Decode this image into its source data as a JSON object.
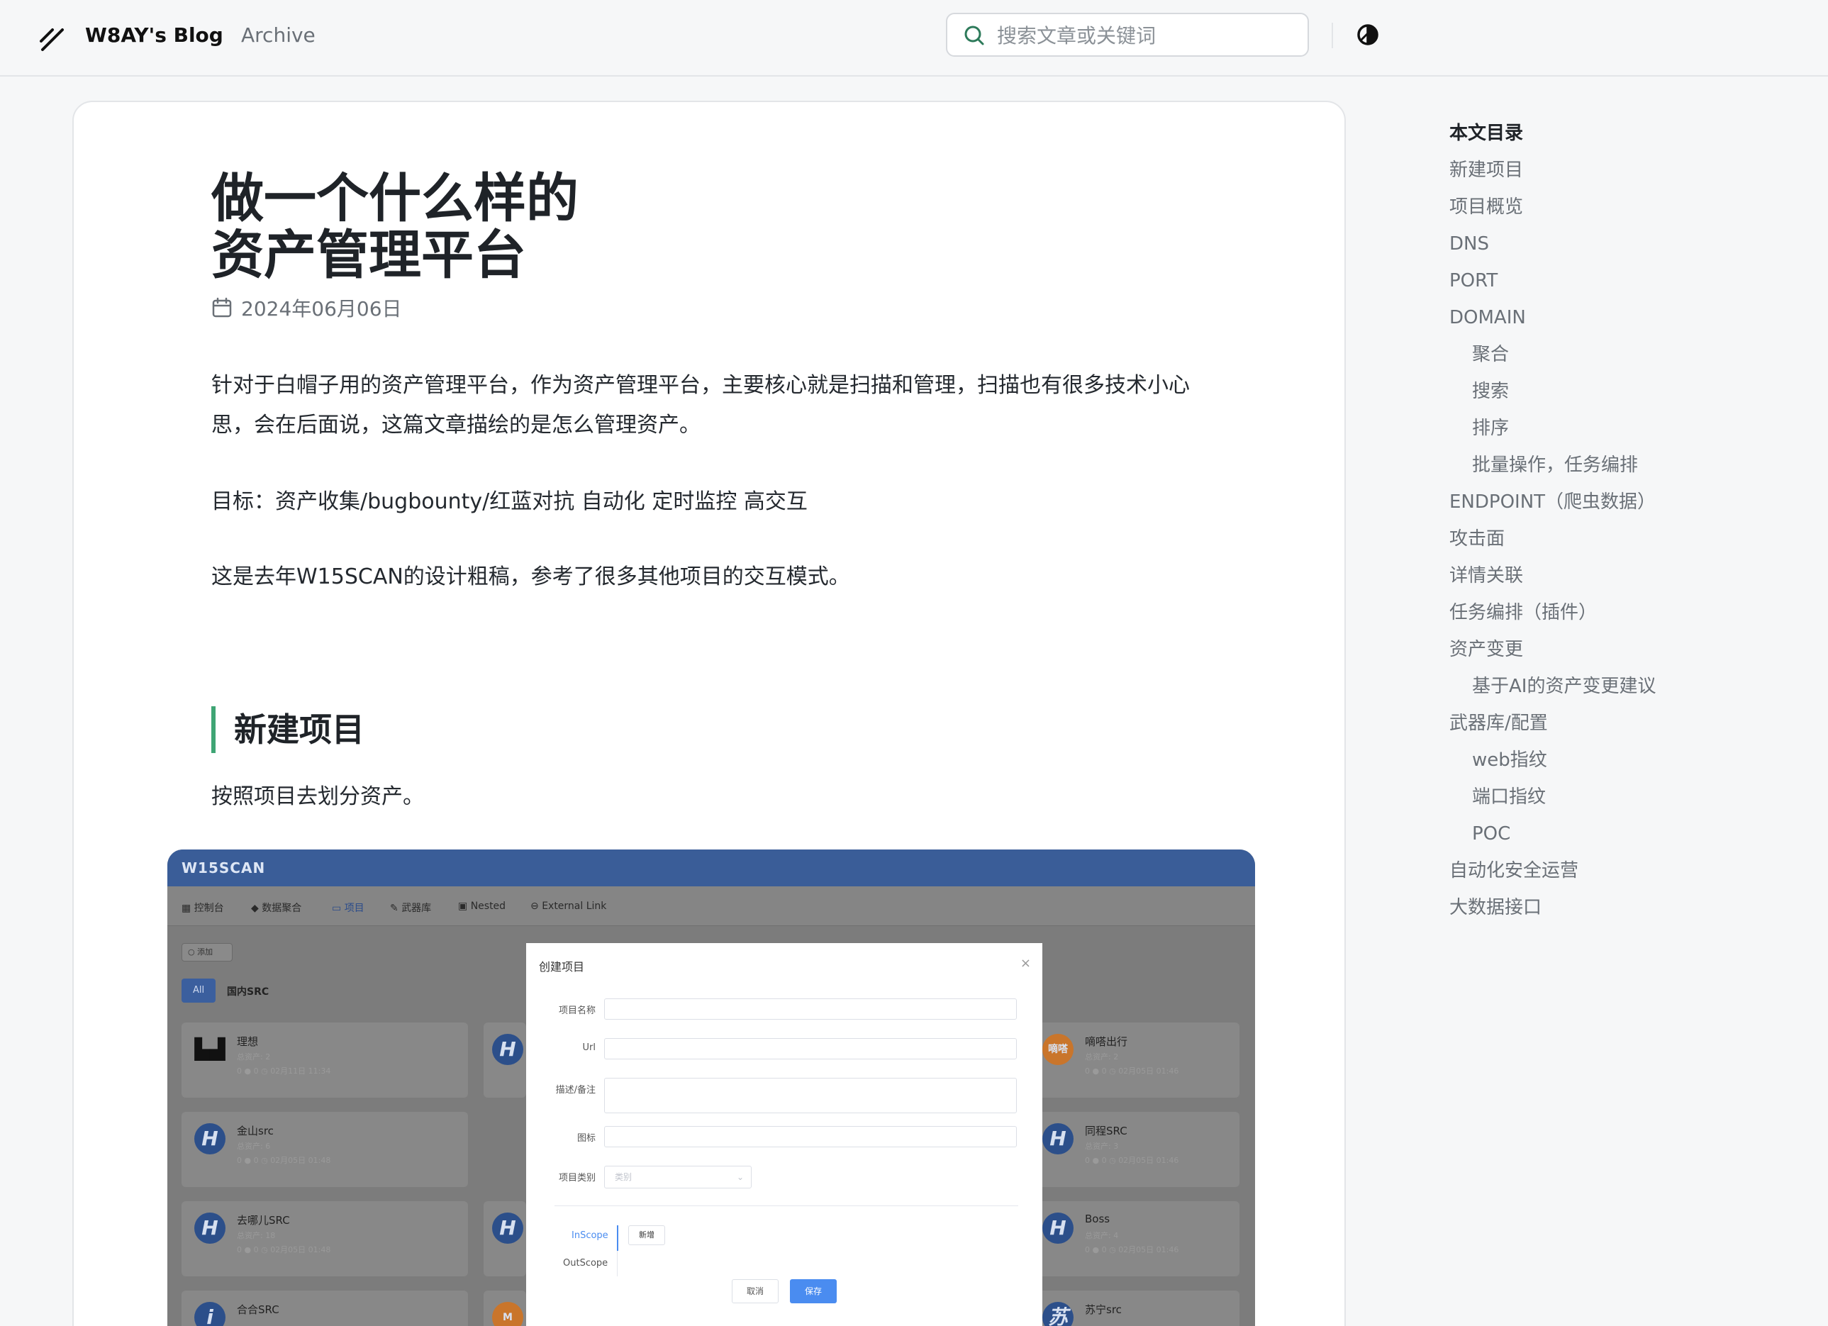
{
  "header": {
    "brand": "W8AY's Blog",
    "nav_archive": "Archive",
    "search_placeholder": "搜索文章或关键词"
  },
  "article": {
    "title_line1": "做一个什么样的",
    "title_line2": "资产管理平台",
    "date": "2024年06月06日",
    "para1": "针对于白帽子用的资产管理平台，作为资产管理平台，主要核心就是扫描和管理，扫描也有很多技术小心思，会在后面说，这篇文章描绘的是怎么管理资产。",
    "para2": "目标：资产收集/bugbounty/红蓝对抗 自动化 定时监控 高交互",
    "para3": "这是去年W15SCAN的设计粗稿，参考了很多其他项目的交互模式。",
    "section1_heading": "新建项目",
    "section1_para": "按照项目去划分资产。"
  },
  "screenshot": {
    "logo": "W15SCAN",
    "menu": [
      "控制台",
      "数据聚合",
      "项目",
      "武器库",
      "Nested",
      "External Link"
    ],
    "add_label": "添加",
    "tab_all": "All",
    "tab_src": "国内SRC",
    "cards": [
      {
        "name": "理想",
        "sub": "总资产: 2",
        "time": "02月11日 11:34"
      },
      {
        "name": "嘀嗒出行",
        "sub": "总资产: 2",
        "time": "02月05日 01:46"
      },
      {
        "name": "金山src",
        "sub": "总资产: 6",
        "time": "02月05日 01:48"
      },
      {
        "name": "同程SRC",
        "sub": "总资产: 3",
        "time": "02月05日 01:46"
      },
      {
        "name": "去哪儿SRC",
        "sub": "总资产: 18",
        "time": "02月05日 01:48"
      },
      {
        "name": "Boss",
        "sub": "总资产: 4",
        "time": "02月05日 01:46"
      },
      {
        "name": "合合SRC",
        "sub": "",
        "time": ""
      },
      {
        "name": "苏宁src",
        "sub": "",
        "time": ""
      }
    ],
    "modal": {
      "title": "创建项目",
      "fields": [
        "项目名称",
        "Url",
        "描述/备注",
        "图标",
        "项目类别"
      ],
      "select_placeholder": "类别",
      "scope_in": "InScope",
      "scope_out": "OutScope",
      "new_btn": "新增",
      "cancel": "取消",
      "save": "保存"
    }
  },
  "toc": {
    "title": "本文目录",
    "items": [
      {
        "label": "新建项目",
        "level": 1
      },
      {
        "label": "项目概览",
        "level": 1
      },
      {
        "label": "DNS",
        "level": 1
      },
      {
        "label": "PORT",
        "level": 1
      },
      {
        "label": "DOMAIN",
        "level": 1
      },
      {
        "label": "聚合",
        "level": 2
      },
      {
        "label": "搜索",
        "level": 2
      },
      {
        "label": "排序",
        "level": 2
      },
      {
        "label": "批量操作，任务编排",
        "level": 2
      },
      {
        "label": "ENDPOINT（爬虫数据）",
        "level": 1
      },
      {
        "label": "攻击面",
        "level": 1
      },
      {
        "label": "详情关联",
        "level": 1
      },
      {
        "label": "任务编排（插件）",
        "level": 1
      },
      {
        "label": "资产变更",
        "level": 1
      },
      {
        "label": "基于AI的资产变更建议",
        "level": 2
      },
      {
        "label": "武器库/配置",
        "level": 1
      },
      {
        "label": "web指纹",
        "level": 2
      },
      {
        "label": "端口指纹",
        "level": 2
      },
      {
        "label": "POC",
        "level": 2
      },
      {
        "label": "自动化安全运营",
        "level": 1
      },
      {
        "label": "大数据接口",
        "level": 1
      }
    ]
  },
  "colors": {
    "accent_green": "#3fa574",
    "screenshot_header": "#3a5d98",
    "primary_blue": "#4a8cf0"
  }
}
